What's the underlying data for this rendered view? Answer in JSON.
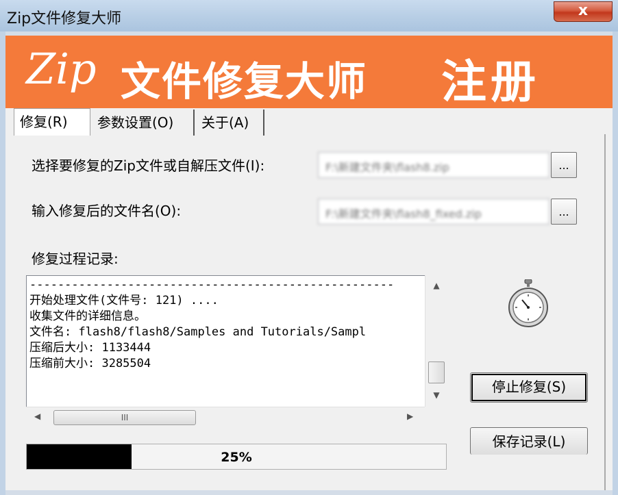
{
  "window": {
    "title": "Zip文件修复大师",
    "close_label": "x"
  },
  "banner": {
    "zip": "Zip",
    "name": "文件修复大师",
    "register": "注册"
  },
  "tabs": [
    {
      "label": "修复(R)"
    },
    {
      "label": "参数设置(O)"
    },
    {
      "label": "关于(A)"
    }
  ],
  "source": {
    "label": "选择要修复的Zip文件或自解压文件(I):",
    "value": "F:\\新建文件夹\\flash8.zip",
    "browse_label": "..."
  },
  "output": {
    "label": "输入修复后的文件名(O):",
    "value": "F:\\新建文件夹\\flash8_fixed.zip",
    "browse_label": "..."
  },
  "log": {
    "label": "修复过程记录:",
    "lines": [
      "----------------------------------------------------",
      "开始处理文件(文件号: 121) ....",
      "收集文件的详细信息。",
      "文件名: flash8/flash8/Samples and Tutorials/Sampl",
      "压缩后大小: 1133444",
      "压缩前大小: 3285504"
    ],
    "hscroll_grip": "III"
  },
  "buttons": {
    "stop": "停止修复(S)",
    "save_log": "保存记录(L)"
  },
  "progress": {
    "value": 0.25,
    "label": "25%"
  },
  "icons": {
    "stopwatch": "stopwatch-icon"
  },
  "colors": {
    "banner": "#f47a3a",
    "close": "#c2371c"
  }
}
